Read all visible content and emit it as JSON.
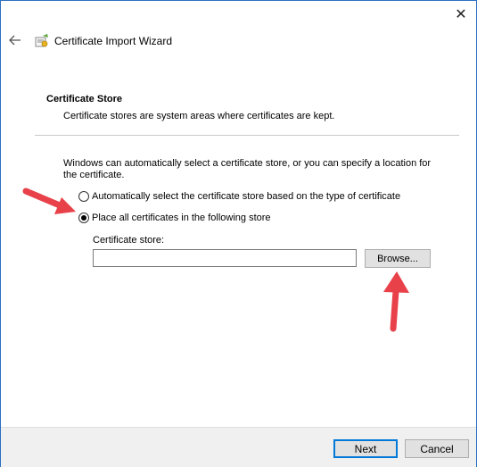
{
  "window": {
    "title": "Certificate Import Wizard",
    "close_glyph": "✕"
  },
  "section": {
    "title": "Certificate Store",
    "description": "Certificate stores are system areas where certificates are kept."
  },
  "intro": "Windows can automatically select a certificate store, or you can specify a location for the certificate.",
  "options": {
    "auto": {
      "label": "Automatically select the certificate store based on the type of certificate",
      "checked": false
    },
    "place": {
      "label": "Place all certificates in the following store",
      "checked": true
    }
  },
  "store": {
    "label": "Certificate store:",
    "value": ""
  },
  "buttons": {
    "browse": "Browse...",
    "next": "Next",
    "cancel": "Cancel"
  },
  "annotation_color": "#e8414a",
  "icons": [
    "back-arrow-icon",
    "certificate-wizard-icon",
    "close-icon"
  ]
}
